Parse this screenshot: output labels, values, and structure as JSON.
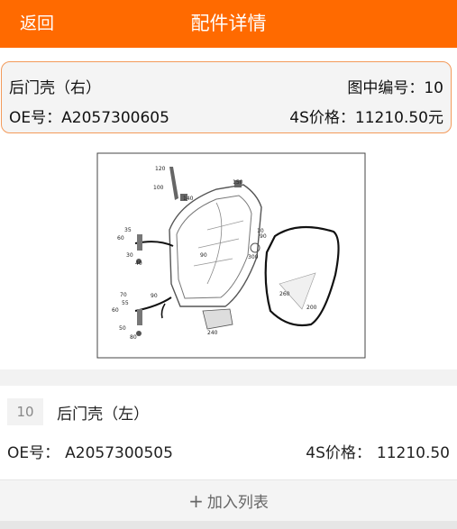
{
  "header": {
    "back_label": "返回",
    "title": "配件详情",
    "bg_color": "#ff6a00"
  },
  "part_info": {
    "name": "后门壳（右）",
    "figure_no_label": "图中编号：10",
    "oe_label": "OE号：A2057300605",
    "price_label": "4S价格：11210.50元",
    "border_color": "#f39a5a"
  },
  "diagram": {
    "callouts": [
      "120",
      "100",
      "140",
      "150",
      "35",
      "60",
      "30",
      "40",
      "10",
      "90",
      "90",
      "300",
      "70",
      "55",
      "90",
      "60",
      "50",
      "80",
      "260",
      "200",
      "240"
    ]
  },
  "part_list": {
    "items": [
      {
        "index": "10",
        "name": "后门壳（左）",
        "oe_label": "OE号：",
        "oe_value": "A2057300505",
        "price_label": "4S价格：",
        "price_value": "11210.50"
      }
    ],
    "add_button": {
      "icon": "plus-icon",
      "label": "加入列表"
    }
  }
}
